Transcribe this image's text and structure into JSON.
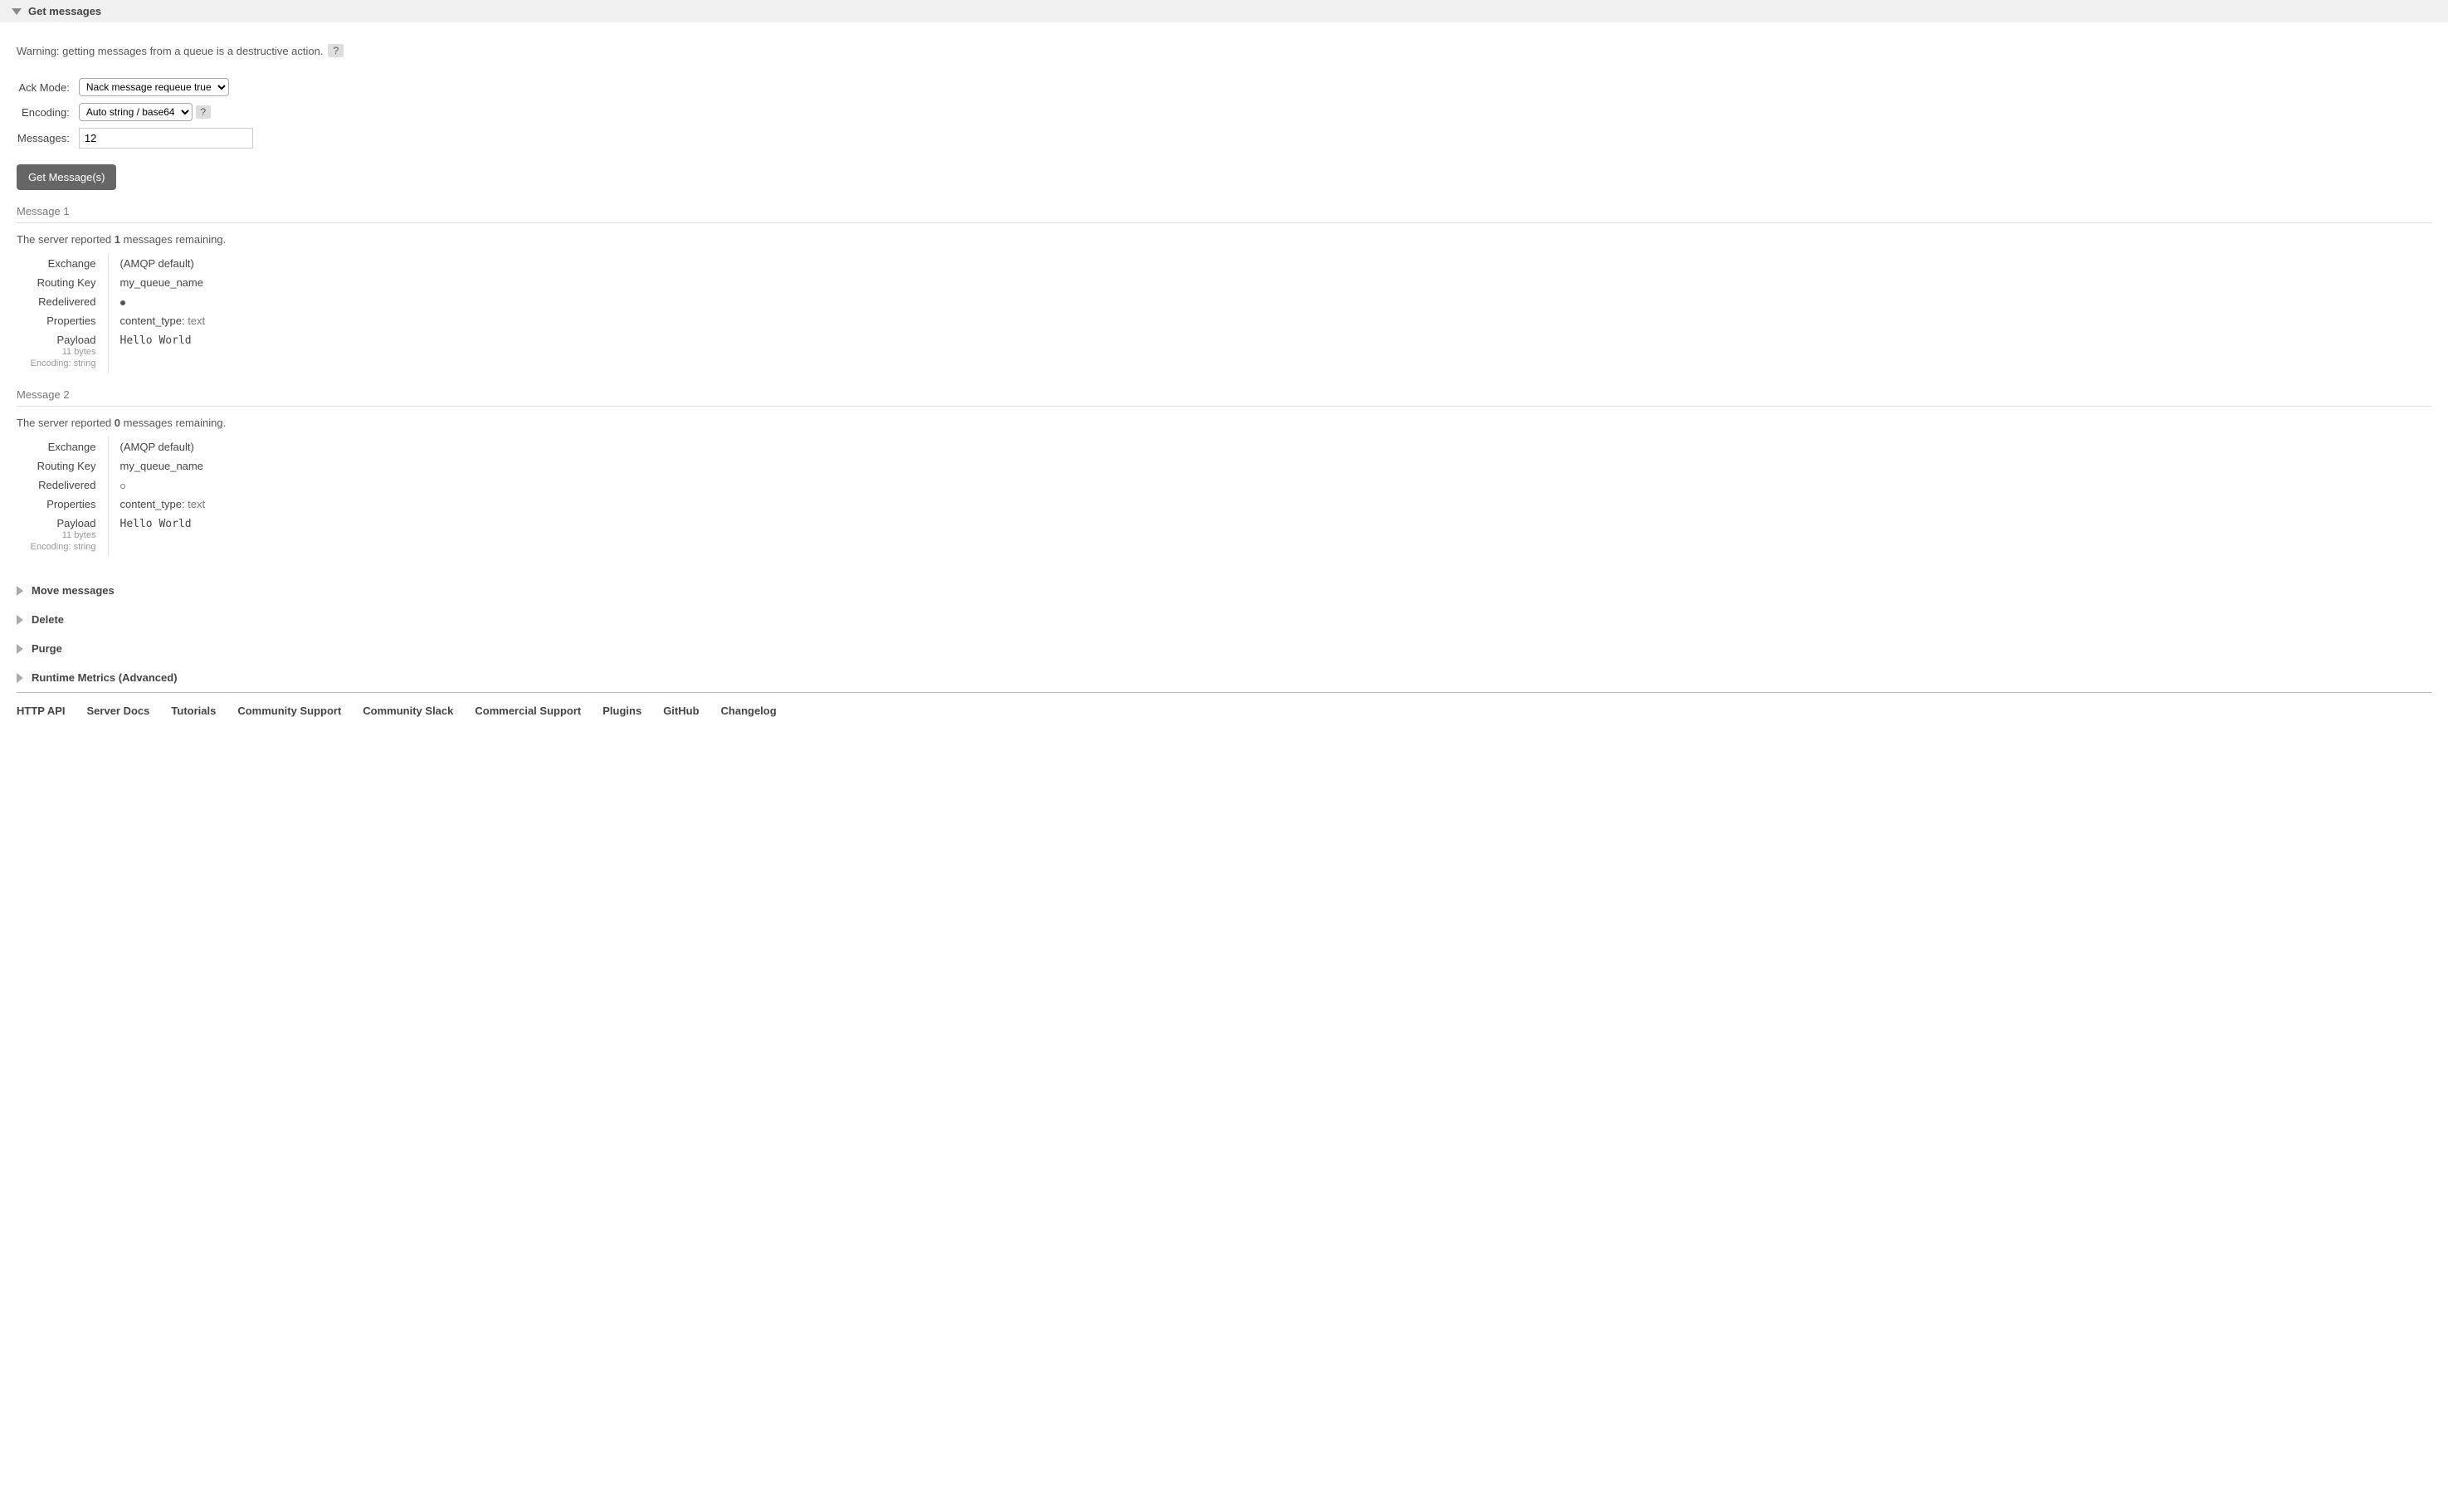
{
  "section": {
    "title": "Get messages",
    "warning": "Warning: getting messages from a queue is a destructive action.",
    "help_glyph": "?"
  },
  "form": {
    "labels": {
      "ack_mode": "Ack Mode:",
      "encoding": "Encoding:",
      "messages": "Messages:"
    },
    "ack_mode_selected": "Nack message requeue true",
    "encoding_selected": "Auto string / base64",
    "messages_value": "12",
    "submit_label": "Get Message(s)"
  },
  "msg_labels": {
    "exchange": "Exchange",
    "routing_key": "Routing Key",
    "redelivered": "Redelivered",
    "properties": "Properties",
    "payload": "Payload"
  },
  "messages": [
    {
      "header": "Message 1",
      "remaining_pre": "The server reported ",
      "remaining_n": "1",
      "remaining_post": " messages remaining.",
      "exchange": "(AMQP default)",
      "routing_key": "my_queue_name",
      "redelivered": true,
      "prop_key": "content_type:",
      "prop_val": "text",
      "payload": "Hello World",
      "bytes": "11 bytes",
      "encoding": "Encoding: string"
    },
    {
      "header": "Message 2",
      "remaining_pre": "The server reported ",
      "remaining_n": "0",
      "remaining_post": " messages remaining.",
      "exchange": "(AMQP default)",
      "routing_key": "my_queue_name",
      "redelivered": false,
      "prop_key": "content_type:",
      "prop_val": "text",
      "payload": "Hello World",
      "bytes": "11 bytes",
      "encoding": "Encoding: string"
    }
  ],
  "collapsed_sections": [
    "Move messages",
    "Delete",
    "Purge",
    "Runtime Metrics (Advanced)"
  ],
  "footer_links": [
    "HTTP API",
    "Server Docs",
    "Tutorials",
    "Community Support",
    "Community Slack",
    "Commercial Support",
    "Plugins",
    "GitHub",
    "Changelog"
  ]
}
